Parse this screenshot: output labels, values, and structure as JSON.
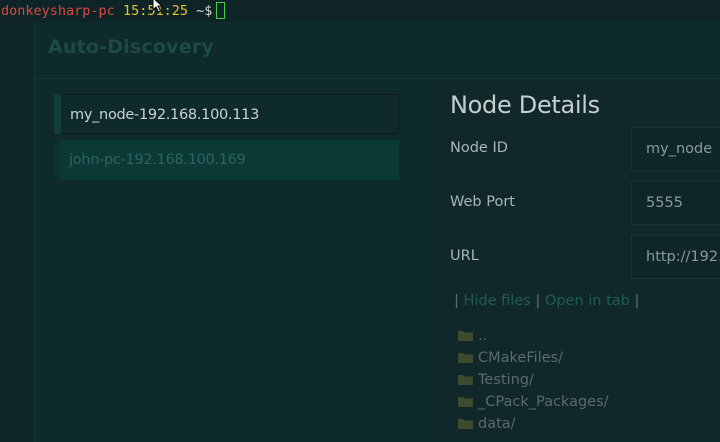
{
  "terminal": {
    "host": "donkeysharp-pc",
    "time": "15:51:25",
    "prompt": "~$"
  },
  "page": {
    "title": "Auto-Discovery"
  },
  "nodes": [
    {
      "label": "my_node-192.168.100.113"
    },
    {
      "label": "john-pc-192.168.100.169"
    }
  ],
  "details": {
    "title": "Node Details",
    "fields": [
      {
        "label": "Node ID",
        "value": "my_node"
      },
      {
        "label": "Web Port",
        "value": "5555"
      },
      {
        "label": "URL",
        "value": "http://192."
      }
    ],
    "links": {
      "separator": "|",
      "hide_files": "Hide files",
      "open_in_tab": "Open in tab"
    },
    "files": [
      {
        "name": ".."
      },
      {
        "name": "CMakeFiles/"
      },
      {
        "name": "Testing/"
      },
      {
        "name": "_CPack_Packages/"
      },
      {
        "name": "data/"
      }
    ]
  },
  "colors": {
    "background": "#0f2628",
    "selected_item_accent": "#133c3c",
    "other_item_bg": "#0b3a36",
    "link": "#1f5c56",
    "host": "#d9493f",
    "time": "#e6c32e",
    "cursor": "#3fcf4a"
  }
}
